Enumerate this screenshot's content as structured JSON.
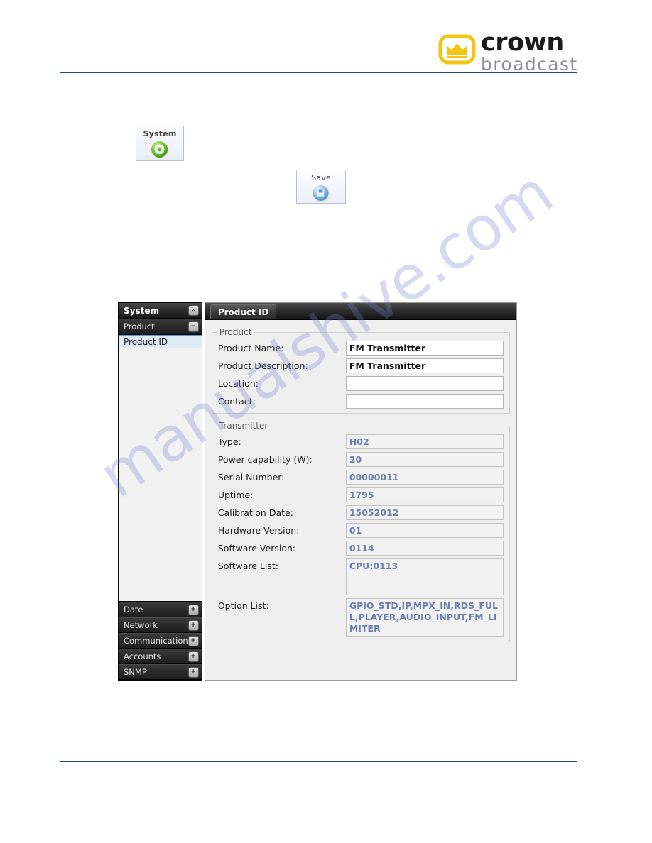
{
  "header": {
    "logo": {
      "icon": "crown-in-rounded-square-icon",
      "primary_text": "crown",
      "secondary_text": "broadcast",
      "icon_color": "#f2c511",
      "primary_color": "#1b1b1b",
      "secondary_color": "#8e8e8e"
    },
    "rule_color": "#1d4f63"
  },
  "toolbar": {
    "system_button": {
      "label": "System",
      "icon": "green-gear-sphere-icon"
    },
    "save_button": {
      "label": "Save",
      "icon": "blue-save-sphere-icon"
    }
  },
  "watermark": {
    "text": "manualshive.com"
  },
  "app": {
    "sidebar": {
      "title": "System",
      "collapse_icon": "«",
      "sections": [
        {
          "label": "Product",
          "toggle": "−",
          "expanded": true
        }
      ],
      "tree_items": [
        {
          "label": "Product ID",
          "selected": true
        }
      ],
      "bottom_sections": [
        {
          "label": "Date",
          "toggle": "+",
          "expanded": false
        },
        {
          "label": "Network",
          "toggle": "+",
          "expanded": false
        },
        {
          "label": "Communication",
          "toggle": "+",
          "expanded": false
        },
        {
          "label": "Accounts",
          "toggle": "+",
          "expanded": false
        },
        {
          "label": "SNMP",
          "toggle": "+",
          "expanded": false
        }
      ]
    },
    "tabs": [
      {
        "label": "Product ID",
        "active": true
      }
    ],
    "groups": [
      {
        "legend": "Product",
        "fields": [
          {
            "label": "Product Name:",
            "value": "FM Transmitter",
            "readonly": false
          },
          {
            "label": "Product Description:",
            "value": "FM Transmitter",
            "readonly": false
          },
          {
            "label": "Location:",
            "value": "",
            "readonly": false
          },
          {
            "label": "Contact:",
            "value": "",
            "readonly": false
          }
        ]
      },
      {
        "legend": "Transmitter",
        "fields": [
          {
            "label": "Type:",
            "value": "H02",
            "readonly": true
          },
          {
            "label": "Power capability (W):",
            "value": "20",
            "readonly": true
          },
          {
            "label": "Serial Number:",
            "value": "00000011",
            "readonly": true
          },
          {
            "label": "Uptime:",
            "value": "1795",
            "readonly": true
          },
          {
            "label": "Calibration Date:",
            "value": "15052012",
            "readonly": true
          },
          {
            "label": "Hardware Version:",
            "value": "01",
            "readonly": true
          },
          {
            "label": "Software Version:",
            "value": "0114",
            "readonly": true
          },
          {
            "label": "Software List:",
            "value": "CPU:0113",
            "readonly": true,
            "multiline": true
          },
          {
            "label": "Option List:",
            "value": "GPIO_STD,IP,MPX_IN,RDS_FULL,PLAYER,AUDIO_INPUT,FM_LIMITER",
            "readonly": true,
            "multiline": true
          }
        ]
      }
    ]
  }
}
